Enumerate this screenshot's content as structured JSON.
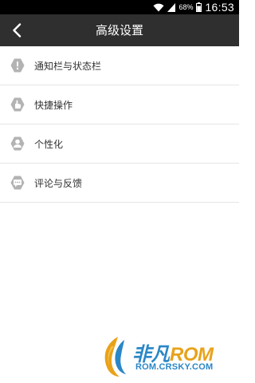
{
  "status_bar": {
    "battery_percent": "68%",
    "time": "16:53",
    "icons": [
      "wifi-icon",
      "signal-icon",
      "battery-icon"
    ]
  },
  "header": {
    "back_icon": "chevron-left-icon",
    "title": "高级设置"
  },
  "menu": {
    "items": [
      {
        "icon": "alert-icon",
        "label": "通知栏与状态栏"
      },
      {
        "icon": "hand-icon",
        "label": "快捷操作"
      },
      {
        "icon": "person-icon",
        "label": "个性化"
      },
      {
        "icon": "comment-icon",
        "label": "评论与反馈"
      }
    ]
  },
  "watermark": {
    "brand_part1": "非凡",
    "brand_part2": "ROM",
    "domain": "ROM.CRSKY.COM"
  },
  "colors": {
    "status_bar_bg": "#000000",
    "title_bar_bg": "#2f2f2f",
    "icon_gray": "#b3b3b3",
    "divider": "#e6e6e6",
    "watermark_blue": "#2a87c7",
    "watermark_orange": "#e8a21a"
  }
}
